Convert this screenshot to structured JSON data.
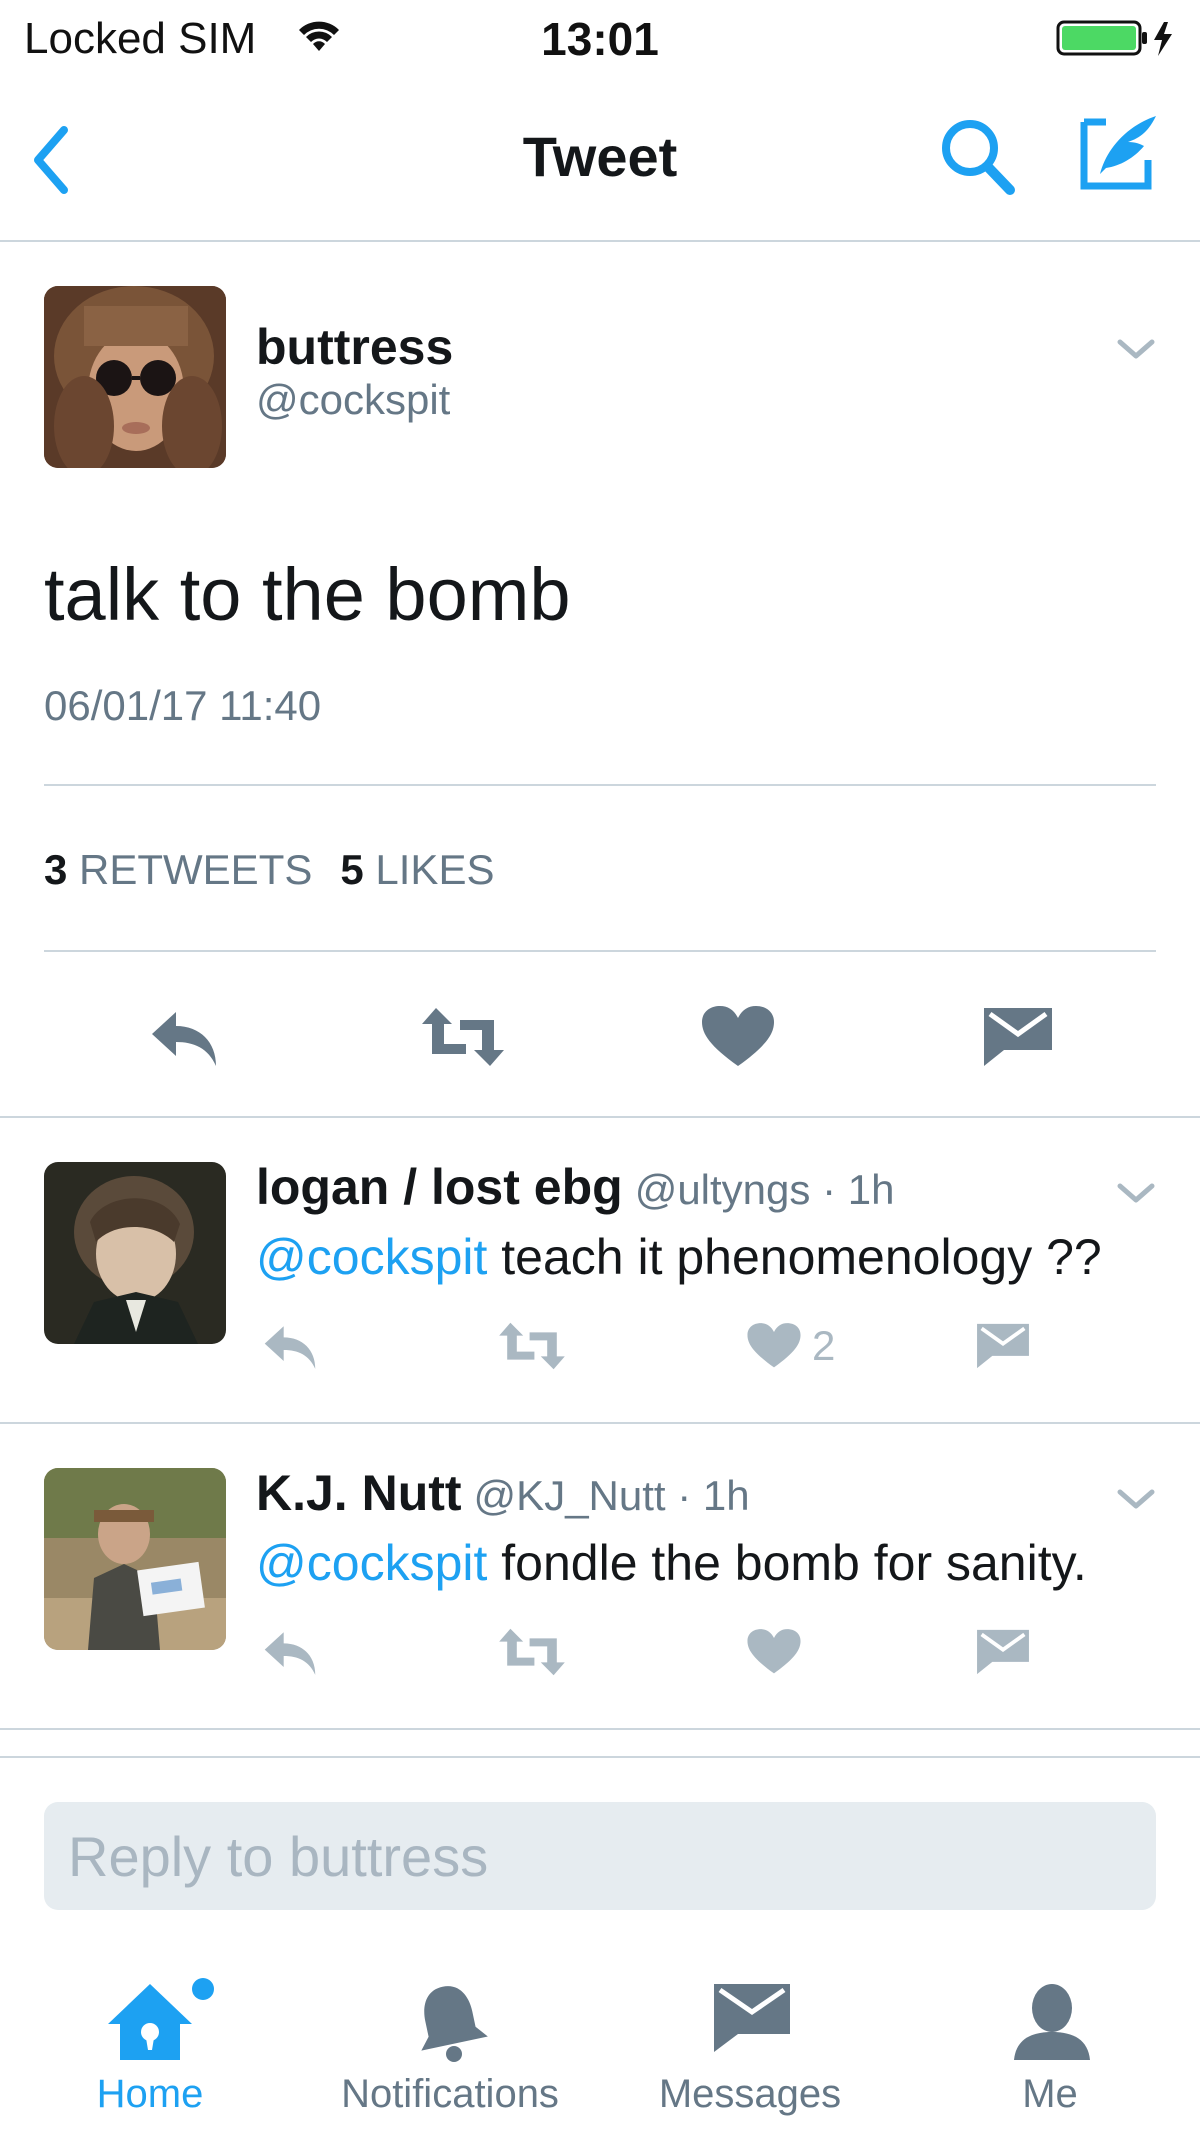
{
  "status_bar": {
    "carrier": "Locked SIM",
    "time": "13:01",
    "battery_color": "#4cd964"
  },
  "nav": {
    "title": "Tweet",
    "accent_color": "#1da1f2"
  },
  "tweet": {
    "author_name": "buttress",
    "author_handle": "@cockspit",
    "text": "talk to the bomb",
    "date": "06/01/17 11:40",
    "retweet_count": "3",
    "retweet_label": "RETWEETS",
    "like_count": "5",
    "like_label": "LIKES"
  },
  "replies": [
    {
      "name": "logan / lost ebg",
      "meta": "@ultyngs · 1h",
      "mention": "@cockspit",
      "text": " teach it phenomenology ??",
      "like_count": "2"
    },
    {
      "name": "K.J. Nutt",
      "meta": "@KJ_Nutt · 1h",
      "mention": "@cockspit",
      "text": " fondle the bomb for sanity.",
      "like_count": ""
    }
  ],
  "reply_box": {
    "placeholder": "Reply to buttress"
  },
  "tabs": [
    {
      "label": "Home",
      "icon": "home-icon",
      "active": true
    },
    {
      "label": "Notifications",
      "icon": "bell-icon",
      "active": false
    },
    {
      "label": "Messages",
      "icon": "envelope-icon",
      "active": false
    },
    {
      "label": "Me",
      "icon": "person-icon",
      "active": false
    }
  ]
}
